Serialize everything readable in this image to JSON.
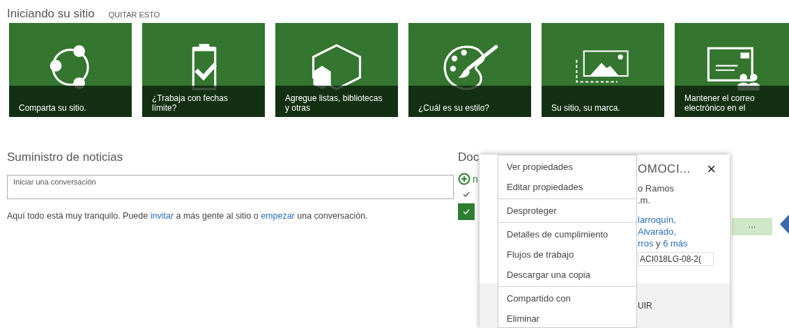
{
  "getting_started": {
    "title": "Iniciando su sitio",
    "dismiss": "QUITAR ESTO",
    "tiles": [
      {
        "kind": "share",
        "label": "Comparta su sitio."
      },
      {
        "kind": "clipboard",
        "label": "¿Trabaja con fechas límite?"
      },
      {
        "kind": "hexagon",
        "label": "Agregue listas, bibliotecas y otras"
      },
      {
        "kind": "palette",
        "label": "¿Cuál es su estilo?"
      },
      {
        "kind": "image",
        "label": "Su sitio, su marca."
      },
      {
        "kind": "mail",
        "label": "Mantener el correo electrónico en el"
      }
    ]
  },
  "feed": {
    "title": "Suministro de noticias",
    "placeholder": "Iniciar una conversación",
    "message": [
      {
        "text": "Aquí todo está muy tranquilo. Puede ",
        "link": false
      },
      {
        "text": "invitar",
        "link": true
      },
      {
        "text": " a más gente al sitio o ",
        "link": false
      },
      {
        "text": "empezar",
        "link": true
      },
      {
        "text": " una conversación.",
        "link": false
      }
    ]
  },
  "documents": {
    "title": "Doc",
    "new_label": "n",
    "rows": [
      {
        "selected": false
      },
      {
        "selected": true
      }
    ],
    "more_button": "..."
  },
  "callout": {
    "title": "OMOCI...",
    "close": "×",
    "lines": [
      [
        {
          "text": "o Ramos",
          "link": false
        }
      ],
      [
        {
          "text": ".m.",
          "link": false
        }
      ],
      [
        {
          "text": "larroquín,",
          "link": true
        }
      ],
      [
        {
          "text": "Alvarado,",
          "link": true
        }
      ],
      [
        {
          "text": "rros",
          "link": true
        },
        {
          "text": " y ",
          "link": false
        },
        {
          "text": "6 más",
          "link": true
        }
      ]
    ],
    "file_name": "ACI018LG-08-2(",
    "footer_action": "UIR"
  },
  "menu": {
    "groups": [
      [
        "Ver propiedades",
        "Editar propiedades"
      ],
      [
        "Desproteger"
      ],
      [
        "Detalles de cumplimiento",
        "Flujos de trabajo",
        "Descargar una copia"
      ],
      [
        "Compartido con",
        "Eliminar"
      ]
    ]
  }
}
